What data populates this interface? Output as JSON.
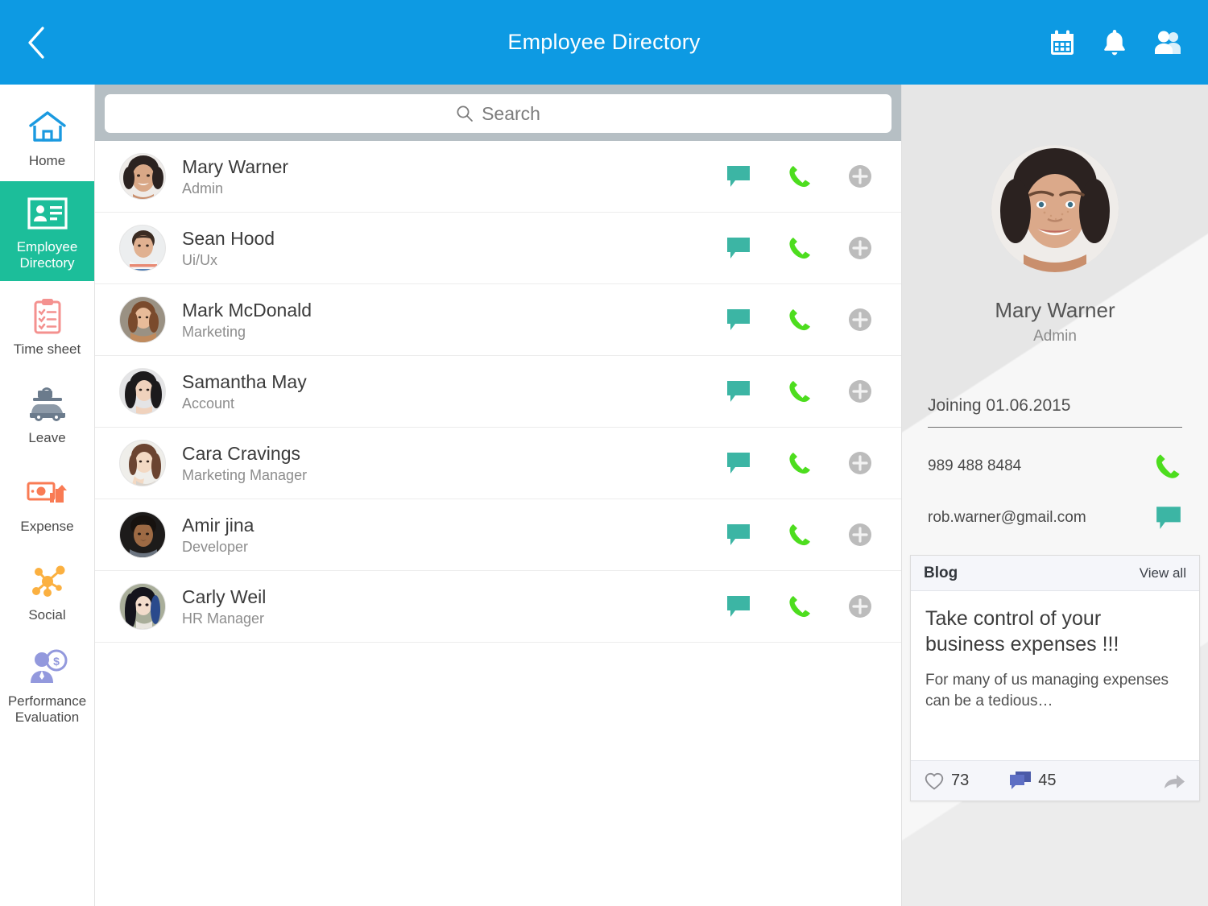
{
  "header": {
    "title": "Employee Directory",
    "back_icon": "chevron-left-icon",
    "actions": [
      {
        "icon": "calendar-icon",
        "name": "calendar"
      },
      {
        "icon": "bell-icon",
        "name": "notifications"
      },
      {
        "icon": "people-icon",
        "name": "contacts"
      }
    ],
    "bg_color": "#0d9ae3"
  },
  "sidebar": {
    "active_color": "#1cbe9a",
    "items": [
      {
        "label": "Home",
        "icon": "home-icon",
        "active": false
      },
      {
        "label": "Employee Directory",
        "icon": "id-card-icon",
        "active": true
      },
      {
        "label": "Time sheet",
        "icon": "clipboard-checklist-icon",
        "active": false
      },
      {
        "label": "Leave",
        "icon": "car-luggage-icon",
        "active": false
      },
      {
        "label": "Expense",
        "icon": "money-chart-icon",
        "active": false
      },
      {
        "label": "Social",
        "icon": "network-nodes-icon",
        "active": false
      },
      {
        "label": "Performance Evaluation",
        "icon": "person-dollar-icon",
        "active": false
      }
    ]
  },
  "search": {
    "placeholder": "Search",
    "value": "",
    "icon": "search-icon"
  },
  "employee_list": {
    "row_actions": [
      {
        "icon": "chat-bubble-icon",
        "color": "#3cb5a4"
      },
      {
        "icon": "phone-icon",
        "color": "#4ddd1e"
      },
      {
        "icon": "plus-circle-icon",
        "color": "#b9b9b9"
      }
    ],
    "rows": [
      {
        "name": "Mary Warner",
        "role": "Admin",
        "avatar": "woman-freckles-avatar"
      },
      {
        "name": "Sean Hood",
        "role": "Ui/Ux",
        "avatar": "man-striped-shirt-avatar"
      },
      {
        "name": "Mark McDonald",
        "role": "Marketing",
        "avatar": "woman-brown-coat-avatar"
      },
      {
        "name": "Samantha May",
        "role": "Account",
        "avatar": "woman-dark-hair-avatar"
      },
      {
        "name": "Cara Cravings",
        "role": "Marketing Manager",
        "avatar": "woman-hand-face-avatar"
      },
      {
        "name": "Amir jina",
        "role": "Developer",
        "avatar": "man-scarf-avatar"
      },
      {
        "name": "Carly Weil",
        "role": "HR Manager",
        "avatar": "woman-blue-hair-avatar"
      }
    ]
  },
  "detail": {
    "avatar": "woman-freckles-avatar",
    "name": "Mary Warner",
    "role": "Admin",
    "joining": "Joining 01.06.2015",
    "phone": "989 488 8484",
    "phone_icon": "phone-icon",
    "email": "rob.warner@gmail.com",
    "email_icon": "chat-bubble-icon"
  },
  "blog": {
    "title": "Blog",
    "view_all": "View all",
    "post_title": "Take control of your business expenses !!!",
    "post_excerpt": "For many of us managing expenses can be a tedious…",
    "like_count": "73",
    "comment_count": "45",
    "like_icon": "heart-outline-icon",
    "comment_icon": "comments-icon",
    "share_icon": "share-arrow-icon"
  }
}
